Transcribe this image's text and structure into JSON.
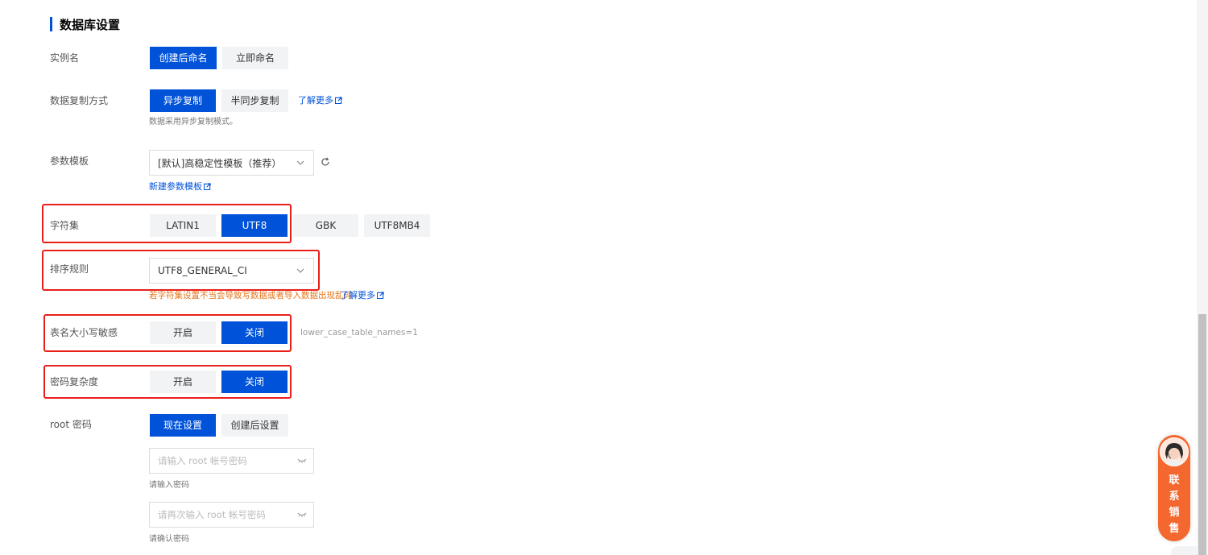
{
  "section_title": "数据库设置",
  "instance_name": {
    "label": "实例名",
    "options": [
      "创建后命名",
      "立即命名"
    ],
    "selected": "创建后命名"
  },
  "replication": {
    "label": "数据复制方式",
    "options": [
      "异步复制",
      "半同步复制"
    ],
    "selected": "异步复制",
    "learn_more": "了解更多",
    "hint": "数据采用异步复制模式。"
  },
  "param_template": {
    "label": "参数模板",
    "selected": "[默认]高稳定性模板（推荐）",
    "new_link": "新建参数模板"
  },
  "charset": {
    "label": "字符集",
    "options": [
      "LATIN1",
      "UTF8",
      "GBK",
      "UTF8MB4"
    ],
    "selected": "UTF8"
  },
  "collation": {
    "label": "排序规则",
    "selected": "UTF8_GENERAL_CI",
    "warning": "若字符集设置不当会导致写数据或者导入数据出现乱码",
    "learn_more": "了解更多"
  },
  "table_case": {
    "label": "表名大小写敏感",
    "options": [
      "开启",
      "关闭"
    ],
    "selected": "关闭",
    "param_hint": "lower_case_table_names=1"
  },
  "password_complexity": {
    "label": "密码复杂度",
    "options": [
      "开启",
      "关闭"
    ],
    "selected": "关闭"
  },
  "root_password": {
    "label": "root 密码",
    "options": [
      "现在设置",
      "创建后设置"
    ],
    "selected": "现在设置",
    "password_placeholder": "请输入 root 帐号密码",
    "password_hint": "请输入密码",
    "confirm_placeholder": "请再次输入 root 帐号密码",
    "confirm_hint": "请确认密码"
  },
  "contact_sales": "联系销售",
  "colors": {
    "primary": "#0052d9",
    "warning": "#e37318",
    "highlight_box": "#e8201a",
    "contact_bg": "#f4682f"
  },
  "icons": [
    "external-link-icon",
    "refresh-icon",
    "chevron-down-icon",
    "eye-closed-icon",
    "avatar"
  ]
}
